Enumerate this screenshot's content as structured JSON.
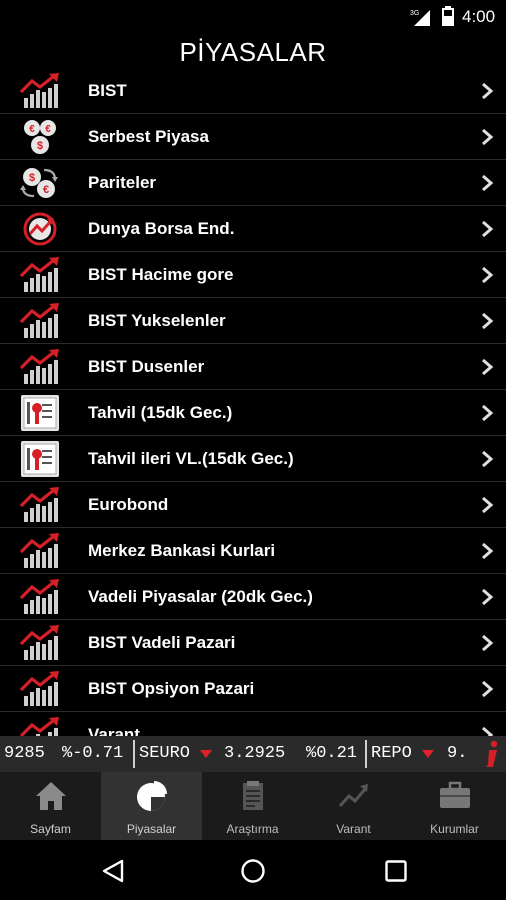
{
  "status_bar": {
    "network": "3G",
    "time": "4:00"
  },
  "page_title": "PİYASALAR",
  "menu": [
    {
      "label": "BIST",
      "icon": "bar-chart-icon"
    },
    {
      "label": "Serbest Piyasa",
      "icon": "currency-coins-icon"
    },
    {
      "label": "Pariteler",
      "icon": "currency-exchange-icon"
    },
    {
      "label": "Dunya Borsa End.",
      "icon": "globe-chart-icon"
    },
    {
      "label": "BIST Hacime gore",
      "icon": "bar-chart-icon"
    },
    {
      "label": "BIST Yukselenler",
      "icon": "bar-chart-icon"
    },
    {
      "label": "BIST Dusenler",
      "icon": "bar-chart-icon"
    },
    {
      "label": "Tahvil (15dk Gec.)",
      "icon": "bond-certificate-icon"
    },
    {
      "label": "Tahvil ileri VL.(15dk Gec.)",
      "icon": "bond-certificate-icon"
    },
    {
      "label": "Eurobond",
      "icon": "bar-chart-icon"
    },
    {
      "label": "Merkez Bankasi Kurlari",
      "icon": "bar-chart-icon"
    },
    {
      "label": "Vadeli Piyasalar (20dk Gec.)",
      "icon": "bar-chart-icon"
    },
    {
      "label": "BIST Vadeli Pazari",
      "icon": "bar-chart-icon"
    },
    {
      "label": "BIST Opsiyon Pazari",
      "icon": "bar-chart-icon"
    },
    {
      "label": "Varant",
      "icon": "bar-chart-icon"
    }
  ],
  "ticker": {
    "partial_value": "9285",
    "partial_change": "%-0.71",
    "items": [
      {
        "symbol": "SEURO",
        "direction": "down",
        "value": "3.2925",
        "change": "%0.21"
      },
      {
        "symbol": "REPO",
        "direction": "down",
        "value": "9."
      }
    ],
    "down_color": "#e0202a"
  },
  "tabs": [
    {
      "label": "Sayfam",
      "icon": "home-icon"
    },
    {
      "label": "Piyasalar",
      "icon": "pie-chart-icon",
      "active": true
    },
    {
      "label": "Araştırma",
      "icon": "document-icon"
    },
    {
      "label": "Varant",
      "icon": "trend-chart-icon"
    },
    {
      "label": "Kurumlar",
      "icon": "briefcase-icon"
    }
  ],
  "colors": {
    "accent_red": "#d62027",
    "background": "#000000",
    "tabbar": "#1b1b1b"
  }
}
